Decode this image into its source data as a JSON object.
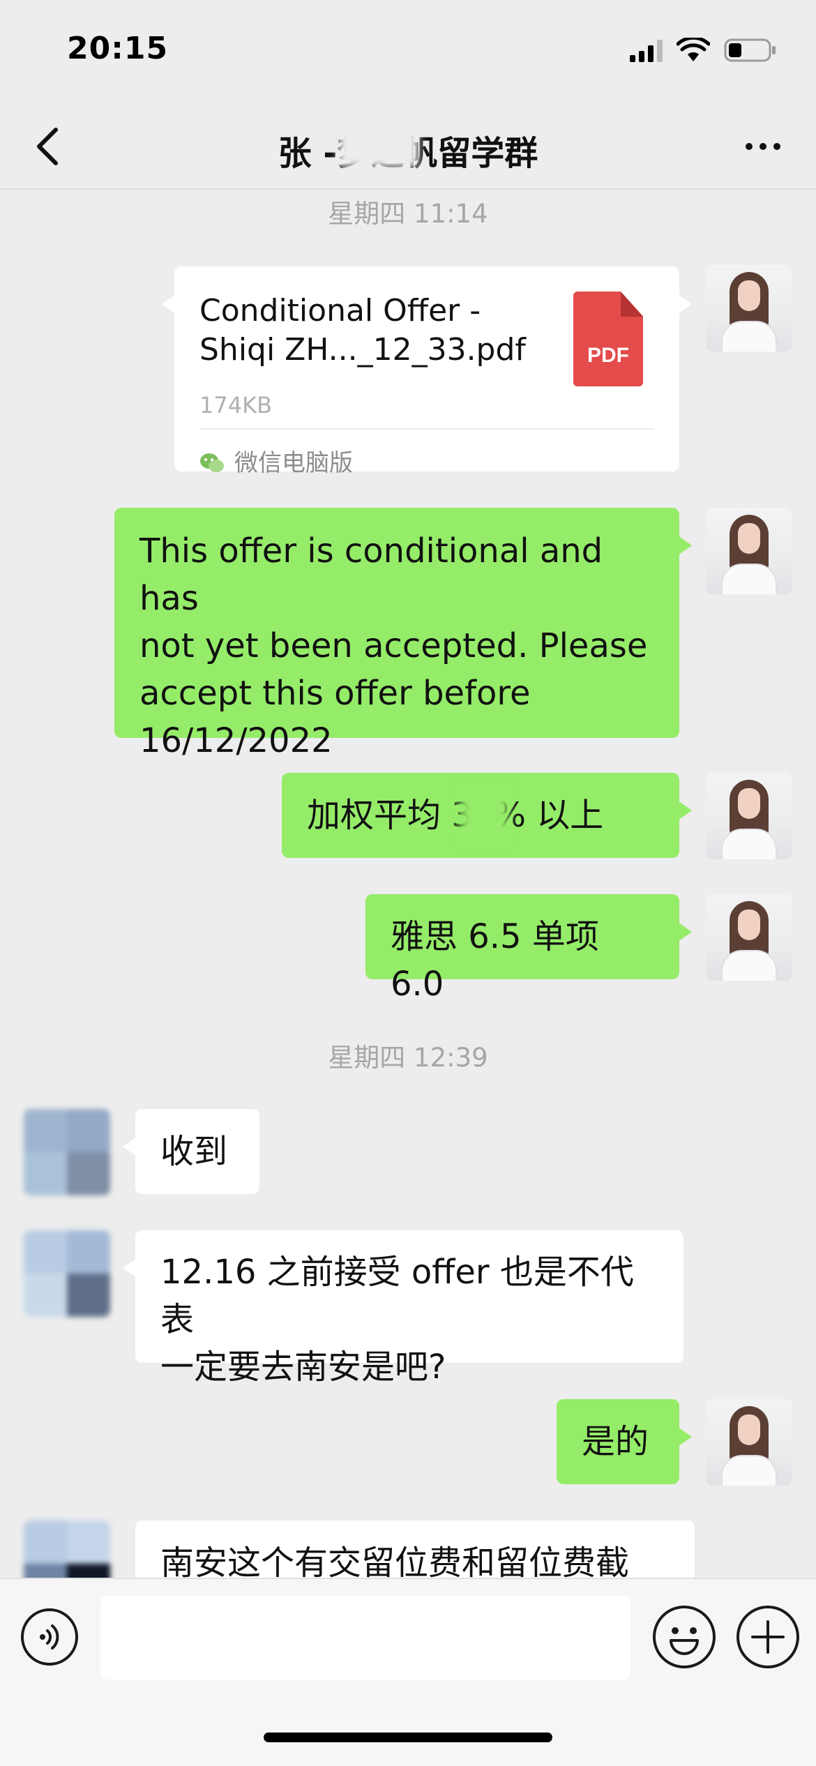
{
  "status_bar": {
    "time": "20:15"
  },
  "header": {
    "title": "张      -梦之帆留学群",
    "back_icon": "chevron-left-icon",
    "more_icon": "more-dots-icon"
  },
  "colors": {
    "sent_bubble": "#95ec69",
    "received_bubble": "#ffffff",
    "background": "#ededed",
    "pdf_red": "#e44b4b"
  },
  "timestamps": {
    "first": "星期四 11:14",
    "second": "星期四 12:39"
  },
  "file_message": {
    "name_line1": "Conditional Offer -",
    "name_line2": "Shiqi ZH..._12_33.pdf",
    "size": "174KB",
    "icon_label": "PDF",
    "source": "微信电脑版"
  },
  "messages": {
    "offer_note_lines": [
      "This offer is conditional and has",
      "not yet been accepted. Please",
      "accept this offer before",
      "16/12/2022"
    ],
    "weighted_average": "加权平均  33% 以上",
    "ielts": "雅思 6.5 单项 6.0",
    "received_ack": "收到",
    "question_lines": [
      "12.16 之前接受 offer 也是不代表",
      "一定要去南安是吧?"
    ],
    "reply_yes": "是的",
    "partial_question": "南安这个有交留位费和留位费截"
  },
  "input": {
    "value": "",
    "placeholder": ""
  }
}
